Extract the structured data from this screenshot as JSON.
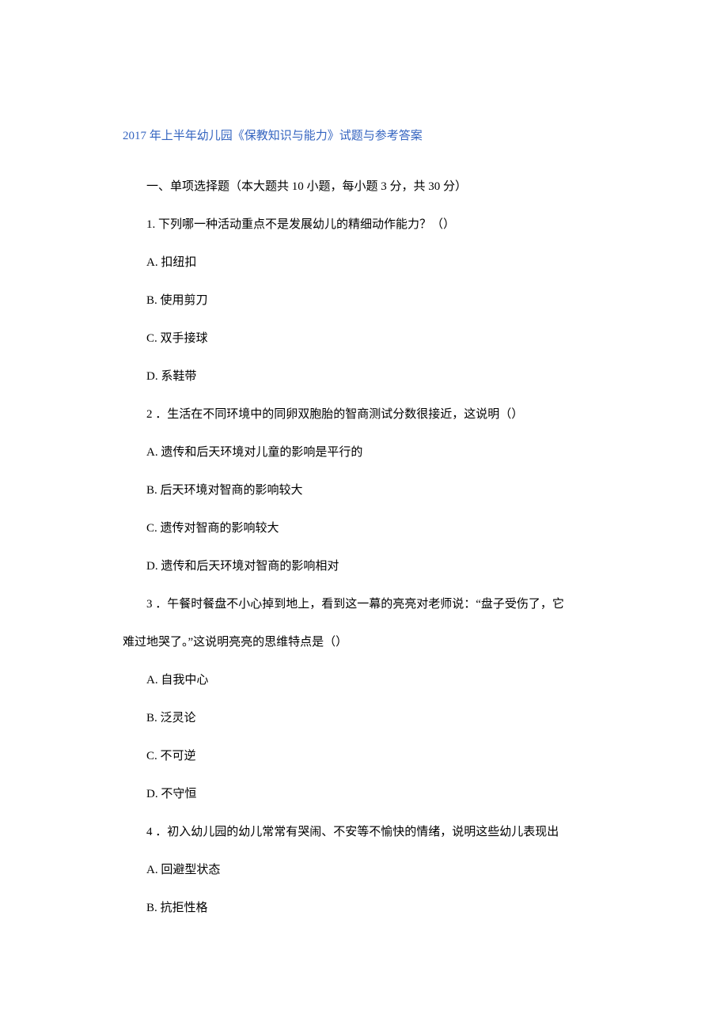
{
  "title": "2017 年上半年幼儿园《保教知识与能力》试题与参考答案",
  "section_heading": "一、单项选择题（本大题共 10 小题，每小题 3 分，共 30 分）",
  "questions": [
    {
      "stem": "1. 下列哪一种活动重点不是发展幼儿的精细动作能力？（）",
      "options": [
        "A. 扣纽扣",
        "B. 使用剪刀",
        "C. 双手接球",
        "D. 系鞋带"
      ]
    },
    {
      "stem": "2 ．生活在不同环境中的同卵双胞胎的智商测试分数很接近，这说明（）",
      "options": [
        "A. 遗传和后天环境对儿童的影响是平行的",
        "B. 后天环境对智商的影响较大",
        "C. 遗传对智商的影响较大",
        "D. 遗传和后天环境对智商的影响相对"
      ]
    },
    {
      "stem_first": "3 ．午餐时餐盘不小心掉到地上，看到这一幕的亮亮对老师说：“盘子受伤了，它",
      "stem_cont": "难过地哭了。”这说明亮亮的思维特点是（）",
      "options": [
        "A. 自我中心",
        "B. 泛灵论",
        "C. 不可逆",
        "D. 不守恒"
      ]
    },
    {
      "stem": "4 ．初入幼儿园的幼儿常常有哭闹、不安等不愉快的情绪，说明这些幼儿表现出",
      "options": [
        "A. 回避型状态",
        "B. 抗拒性格"
      ]
    }
  ]
}
